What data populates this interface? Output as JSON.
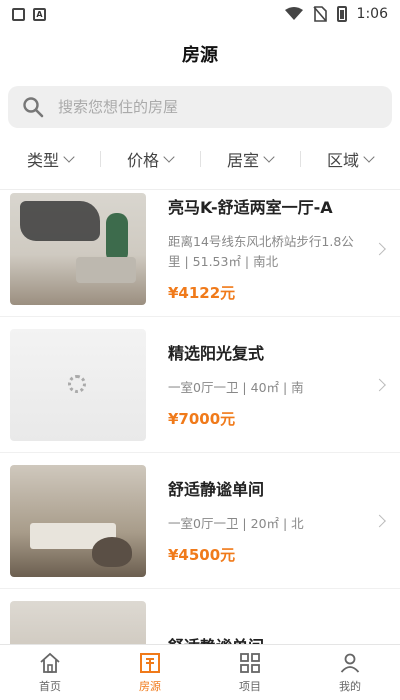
{
  "status_bar": {
    "time": "1:06"
  },
  "header": {
    "title": "房源"
  },
  "search": {
    "placeholder": "搜索您想住的房屋"
  },
  "filters": [
    {
      "label": "类型"
    },
    {
      "label": "价格"
    },
    {
      "label": "居室"
    },
    {
      "label": "区域"
    }
  ],
  "listings": [
    {
      "name": "亮马K-舒适两室一厅-A",
      "meta": "距离14号线东风北桥站步行1.8公里 | 51.53㎡ | 南北",
      "price": "¥4122元"
    },
    {
      "name": "精选阳光复式",
      "meta": "一室0厅一卫 | 40㎡ | 南",
      "price": "¥7000元"
    },
    {
      "name": "舒适静谧单间",
      "meta": "一室0厅一卫 | 20㎡ | 北",
      "price": "¥4500元"
    },
    {
      "name": "舒适静谧单间",
      "meta": "",
      "price": ""
    }
  ],
  "tabs": [
    {
      "label": "首页",
      "icon": "home-icon"
    },
    {
      "label": "房源",
      "icon": "building-icon",
      "active": true
    },
    {
      "label": "项目",
      "icon": "grid-icon"
    },
    {
      "label": "我的",
      "icon": "user-icon"
    }
  ],
  "colors": {
    "accent": "#f07a1a",
    "background": "#ffffff",
    "search_bg": "#efefef"
  }
}
